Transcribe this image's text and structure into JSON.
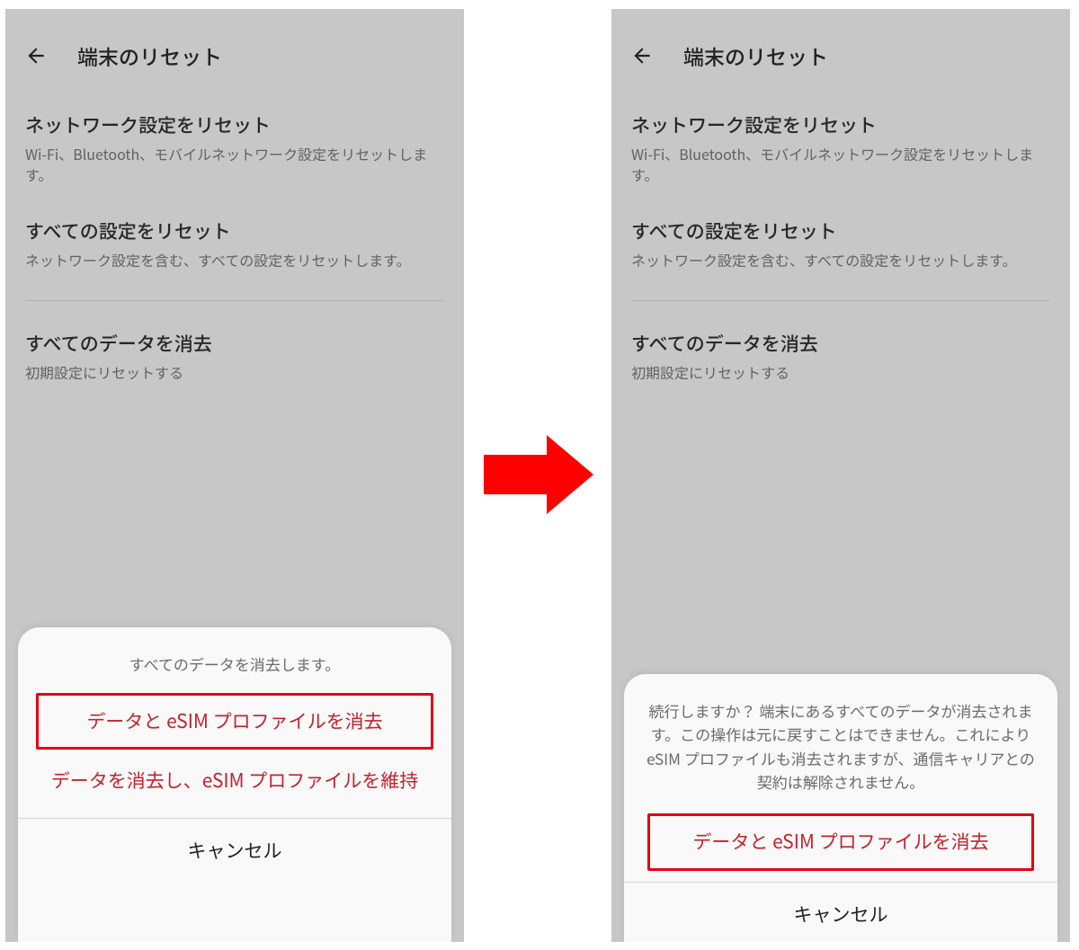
{
  "left": {
    "header": {
      "title": "端末のリセット"
    },
    "items": [
      {
        "title": "ネットワーク設定をリセット",
        "desc": "Wi-Fi、Bluetooth、モバイルネットワーク設定をリセットします。"
      },
      {
        "title": "すべての設定をリセット",
        "desc": "ネットワーク設定を含む、すべての設定をリセットします。"
      },
      {
        "title": "すべてのデータを消去",
        "desc": "初期設定にリセットする"
      }
    ],
    "sheet": {
      "title": "すべてのデータを消去します。",
      "option_erase_all": "データと eSIM プロファイルを消去",
      "option_keep_esim": "データを消去し、eSIM プロファイルを維持",
      "cancel": "キャンセル"
    }
  },
  "right": {
    "header": {
      "title": "端末のリセット"
    },
    "items": [
      {
        "title": "ネットワーク設定をリセット",
        "desc": "Wi-Fi、Bluetooth、モバイルネットワーク設定をリセットします。"
      },
      {
        "title": "すべての設定をリセット",
        "desc": "ネットワーク設定を含む、すべての設定をリセットします。"
      },
      {
        "title": "すべてのデータを消去",
        "desc": "初期設定にリセットする"
      }
    ],
    "sheet": {
      "body": "続行しますか？ 端末にあるすべてのデータが消去されます。この操作は元に戻すことはできません。これにより eSIM プロファイルも消去されますが、通信キャリアとの契約は解除されません。",
      "confirm": "データと eSIM プロファイルを消去",
      "cancel": "キャンセル"
    }
  },
  "colors": {
    "arrow": "#ff0000",
    "danger": "#c6222d",
    "highlight_border": "#e60012",
    "bg_dim": "#c7c7c7"
  }
}
